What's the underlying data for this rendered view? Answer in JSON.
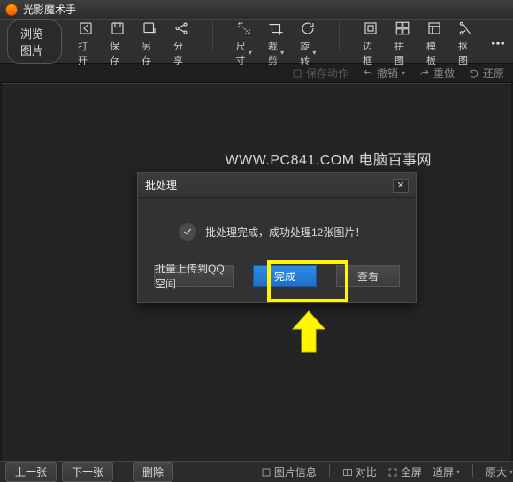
{
  "app": {
    "title": "光影魔术手"
  },
  "toolbar": {
    "browse": "浏览图片",
    "items": [
      {
        "label": "打开"
      },
      {
        "label": "保存"
      },
      {
        "label": "另存"
      },
      {
        "label": "分享"
      },
      {
        "label": "尺寸"
      },
      {
        "label": "裁剪"
      },
      {
        "label": "旋转"
      },
      {
        "label": "边框"
      },
      {
        "label": "拼图"
      },
      {
        "label": "模板"
      },
      {
        "label": "抠图"
      }
    ]
  },
  "actions": {
    "save_action": "保存动作",
    "undo": "撤销",
    "redo": "重做",
    "restore": "还原"
  },
  "watermark": "WWW.PC841.COM 电脑百事网",
  "dialog": {
    "title": "批处理",
    "message": "批处理完成，成功处理12张图片！",
    "btn_upload": "批量上传到QQ空间",
    "btn_finish": "完成",
    "btn_view": "查看"
  },
  "bottom": {
    "prev": "上一张",
    "next": "下一张",
    "delete": "删除",
    "right": {
      "info": "图片信息",
      "compare": "对比",
      "fullscreen": "全屏",
      "fitscreen": "适屏",
      "original": "原大"
    }
  }
}
